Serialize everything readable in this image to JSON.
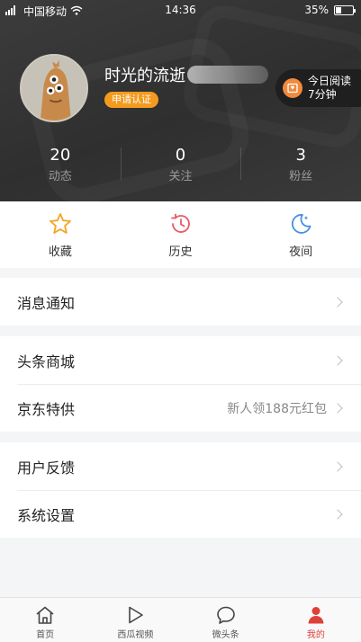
{
  "status_bar": {
    "carrier": "中国移动",
    "time": "14:36",
    "battery": "35%",
    "battery_level": 0.35
  },
  "profile": {
    "username": "时光的流逝",
    "verify_label": "申请认证",
    "reading": {
      "line1": "今日阅读",
      "line2": "7分钟"
    }
  },
  "stats": [
    {
      "value": "20",
      "label": "动态"
    },
    {
      "value": "0",
      "label": "关注"
    },
    {
      "value": "3",
      "label": "粉丝"
    }
  ],
  "quick_actions": [
    {
      "label": "收藏",
      "icon": "star-icon"
    },
    {
      "label": "历史",
      "icon": "history-clock-icon"
    },
    {
      "label": "夜间",
      "icon": "moon-icon"
    }
  ],
  "menu": {
    "notifications": "消息通知",
    "mall": "头条商城",
    "jd": "京东特供",
    "jd_extra": "新人领188元红包",
    "feedback": "用户反馈",
    "settings": "系统设置"
  },
  "tabbar": [
    {
      "label": "首页",
      "icon": "home-icon"
    },
    {
      "label": "西瓜视频",
      "icon": "play-icon"
    },
    {
      "label": "微头条",
      "icon": "chat-bubble-icon"
    },
    {
      "label": "我的",
      "icon": "user-icon",
      "active": true
    }
  ],
  "colors": {
    "accent": "#f49b1f",
    "tab_active": "#e0403a",
    "header_bg": "#333333"
  }
}
